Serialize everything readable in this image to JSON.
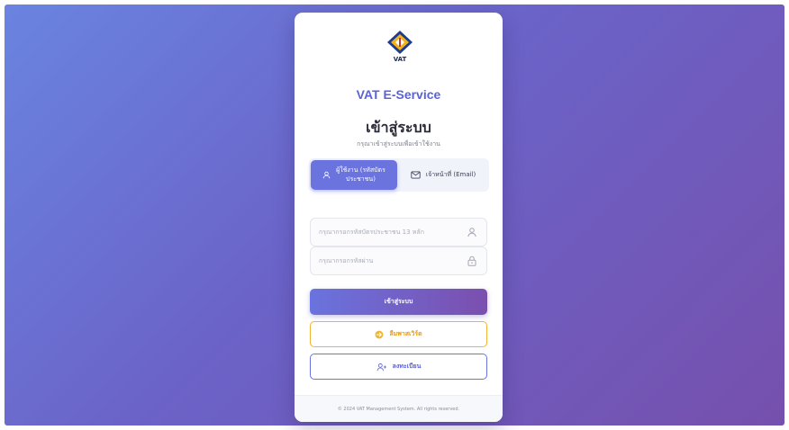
{
  "brand": {
    "logo_text": "VAT",
    "name": "VAT E-Service"
  },
  "login": {
    "title": "เข้าสู่ระบบ",
    "subtitle": "กรุณาเข้าสู่ระบบเพื่อเข้าใช้งาน"
  },
  "tabs": [
    {
      "label_line1": "ผู้ใช้งาน (รหัสบัตร",
      "label_line2": "ประชาชน)",
      "icon": "user-icon",
      "active": true
    },
    {
      "label": "เจ้าหน้าที่ (Email)",
      "icon": "mail-icon",
      "active": false
    }
  ],
  "fields": {
    "id_card": {
      "placeholder": "กรุณากรอกรหัสบัตรประชาชน 13 หลัก",
      "value": "",
      "icon": "user-icon"
    },
    "password": {
      "placeholder": "กรุณากรอกรหัสผ่าน",
      "value": "",
      "icon": "lock-icon"
    }
  },
  "buttons": {
    "login": "เข้าสู่ระบบ",
    "forgot": "ลืมพาสเวิร์ด",
    "register": "ลงทะเบียน"
  },
  "footer": {
    "copyright": "© 2024 VAT Management System. All rights reserved."
  },
  "colors": {
    "primary": "#5a62d6",
    "gradient_start": "#6a84e0",
    "gradient_end": "#7650ad",
    "warning": "#f0b532"
  }
}
